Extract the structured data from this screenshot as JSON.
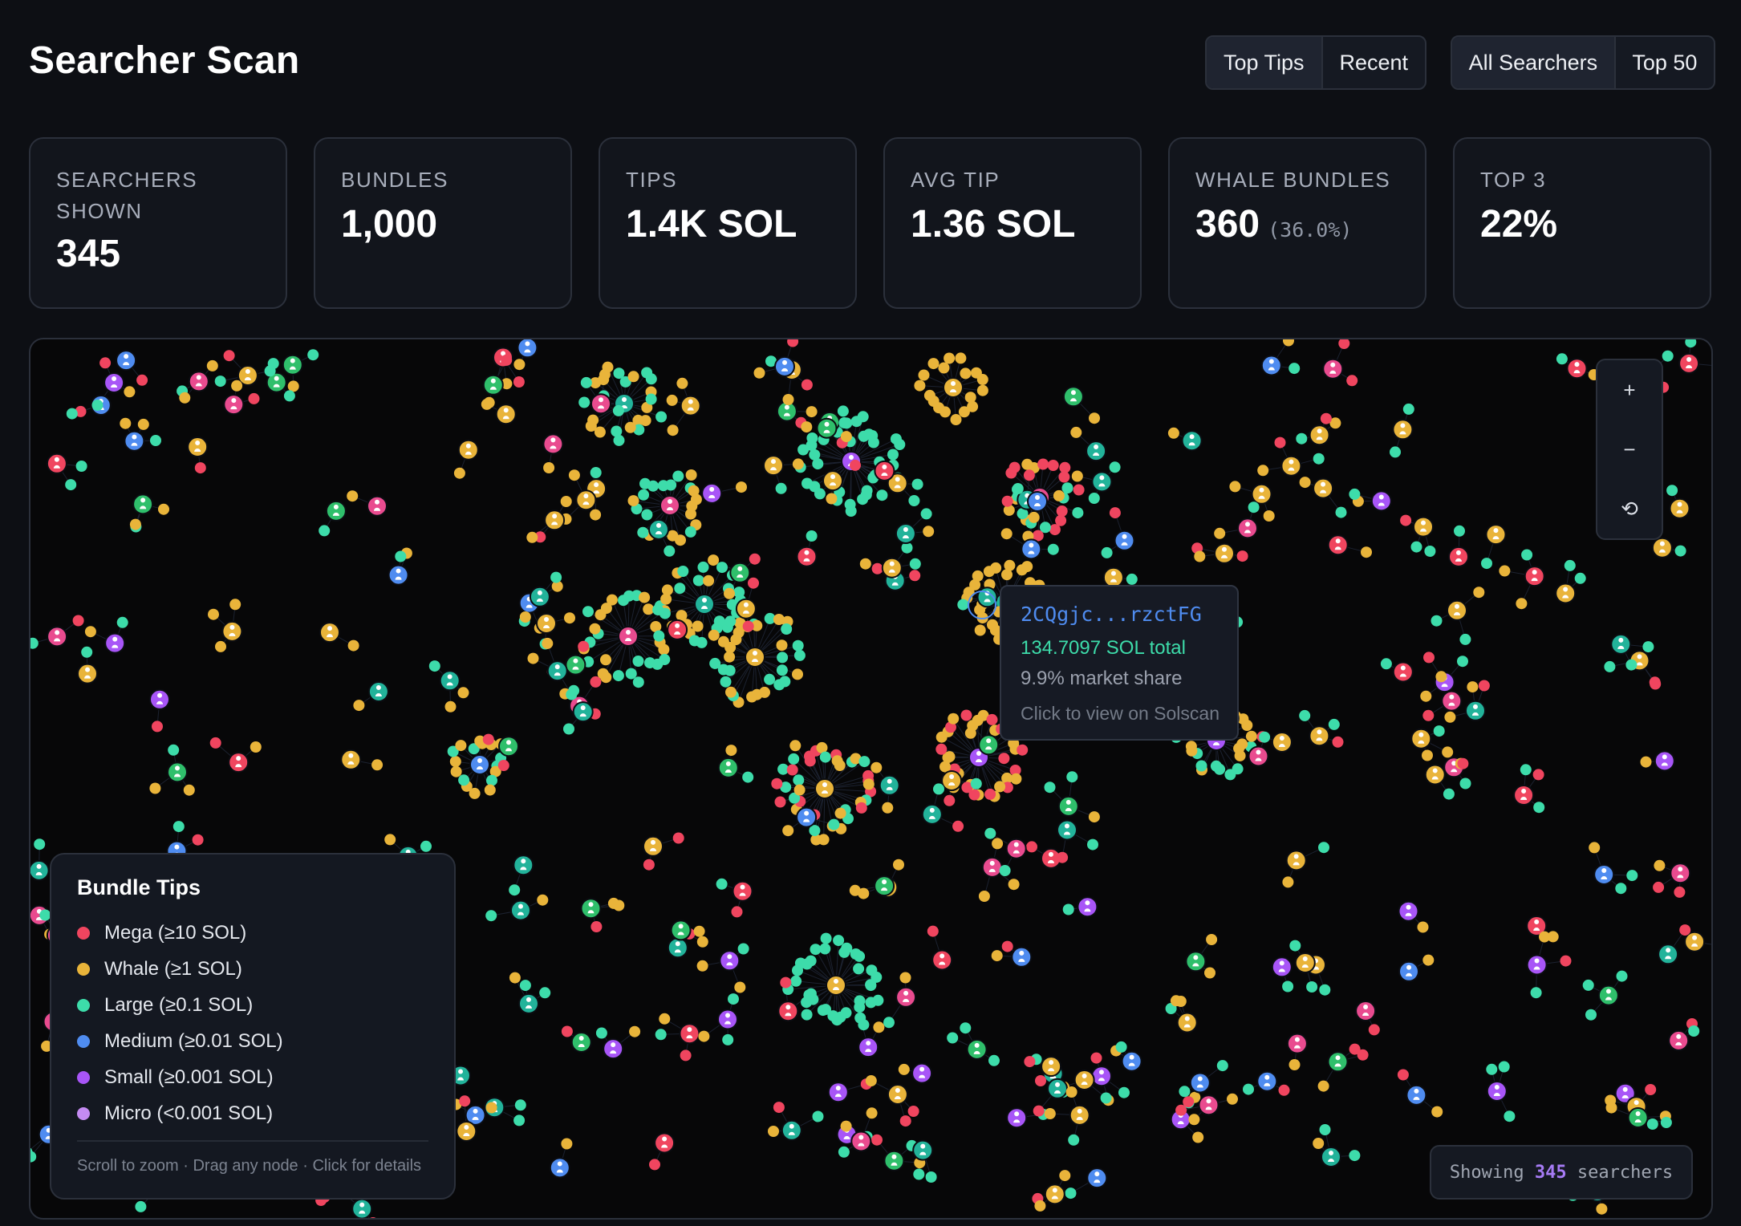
{
  "header": {
    "title": "Searcher Scan",
    "sort_tabs": [
      {
        "label": "Top Tips",
        "active": true
      },
      {
        "label": "Recent",
        "active": false
      }
    ],
    "filter_tabs": [
      {
        "label": "All Searchers",
        "active": true
      },
      {
        "label": "Top 50",
        "active": false
      }
    ]
  },
  "stats": [
    {
      "label": "Searchers Shown",
      "value": "345",
      "sub": ""
    },
    {
      "label": "Bundles",
      "value": "1,000",
      "sub": ""
    },
    {
      "label": "Tips",
      "value": "1.4K SOL",
      "sub": ""
    },
    {
      "label": "Avg Tip",
      "value": "1.36 SOL",
      "sub": ""
    },
    {
      "label": "Whale Bundles",
      "value": "360",
      "sub": "(36.0%)"
    },
    {
      "label": "Top 3",
      "value": "22%",
      "sub": ""
    }
  ],
  "zoom_controls": {
    "zoom_in": "+",
    "zoom_out": "−",
    "reset": "⟲"
  },
  "tooltip": {
    "address": "2CQgjc...rzctFG",
    "total": "134.7097 SOL total",
    "share": "9.9% market share",
    "hint": "Click to view on Solscan"
  },
  "legend": {
    "title": "Bundle Tips",
    "items": [
      {
        "label": "Mega (≥10 SOL)",
        "color": "#f0455f"
      },
      {
        "label": "Whale (≥1 SOL)",
        "color": "#e9b43a"
      },
      {
        "label": "Large (≥0.1 SOL)",
        "color": "#3ddcaa"
      },
      {
        "label": "Medium (≥0.01 SOL)",
        "color": "#4f8cf0"
      },
      {
        "label": "Small (≥0.001 SOL)",
        "color": "#a855f7"
      },
      {
        "label": "Micro (<0.001 SOL)",
        "color": "#c48bf2"
      }
    ],
    "help": "Scroll to zoom · Drag any node · Click for details"
  },
  "footer": {
    "prefix": "Showing ",
    "count": "345",
    "suffix": " searchers"
  },
  "colors": {
    "mega": "#f0455f",
    "whale": "#e9b43a",
    "large": "#3ddcaa",
    "medium": "#4f8cf0",
    "small": "#a855f7",
    "micro": "#c48bf2",
    "pink_searcher": "#e94b8f",
    "green_searcher": "#2fbf6b",
    "teal_searcher": "#22b39a"
  }
}
